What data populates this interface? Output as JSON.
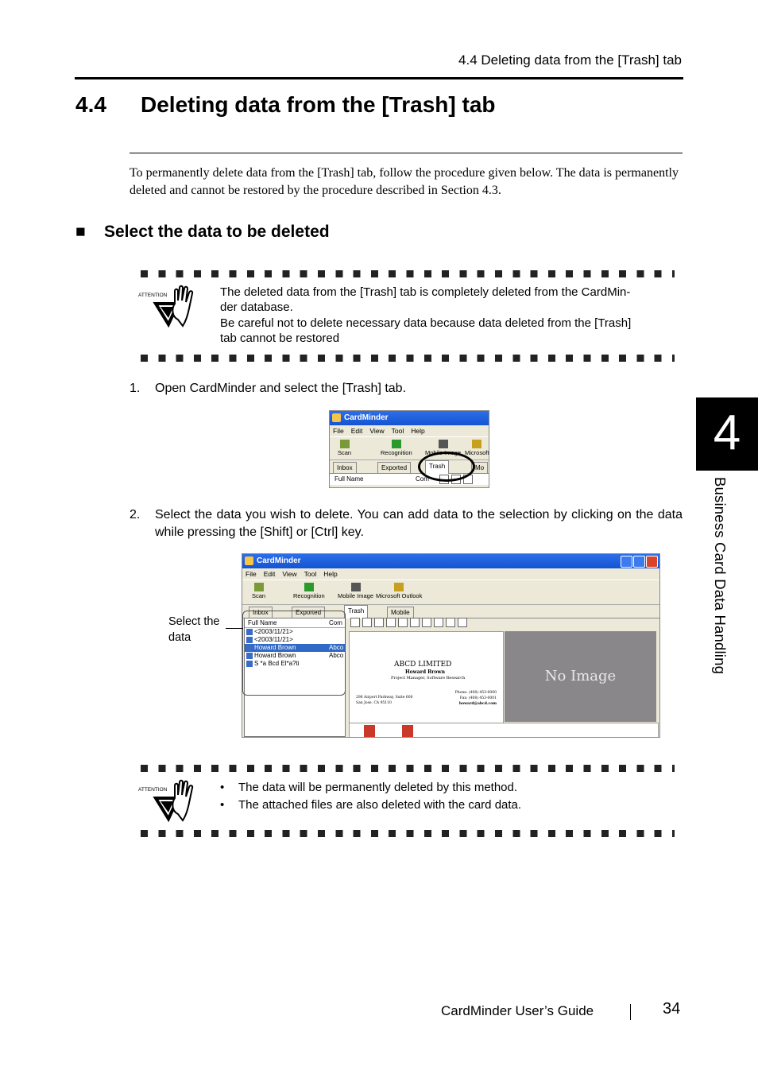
{
  "header": {
    "running_title": "4.4 Deleting data from the [Trash] tab"
  },
  "section": {
    "number": "4.4",
    "title": "Deleting data from the [Trash] tab",
    "intro": "To permanently delete data from the [Trash] tab, follow the procedure given below. The data is permanently deleted and cannot be restored by the procedure described in Section 4.3."
  },
  "subsection": {
    "bullet": "■",
    "title": "Select the data to be deleted"
  },
  "attention1": {
    "icon_label": "ATTENTION",
    "lines": [
      "The deleted data from the [Trash] tab is completely deleted from the CardMin-",
      "der database.",
      "Be careful not to delete necessary data because data deleted from the [Trash]",
      "tab cannot be restored"
    ]
  },
  "steps": [
    {
      "num": "1.",
      "text": "Open CardMinder and select the [Trash] tab."
    },
    {
      "num": "2.",
      "text": "Select the data you wish to delete. You can add data to the selection by clicking on the data while pressing the [Shift] or [Ctrl] key."
    }
  ],
  "screenshot1": {
    "title": "CardMinder",
    "menu": [
      "File",
      "Edit",
      "View",
      "Tool",
      "Help"
    ],
    "tools": [
      "Scan",
      "Recognition",
      "Mobile Image",
      "Microsoft"
    ],
    "tabs": [
      "Inbox",
      "Exported",
      "Trash",
      "Mo"
    ],
    "column": "Full Name",
    "column2": "Com"
  },
  "screenshot2": {
    "title": "CardMinder",
    "menu": [
      "File",
      "Edit",
      "View",
      "Tool",
      "Help"
    ],
    "tools": [
      "Scan",
      "Recognition",
      "Mobile Image",
      "Microsoft Outlook"
    ],
    "tabs": [
      "Inbox",
      "Exported",
      "Trash",
      "Mobile"
    ],
    "column": "Full Name",
    "column2": "Com",
    "rows": [
      {
        "name": "<2003/11/21>",
        "company": ""
      },
      {
        "name": "<2003/11/21>",
        "company": ""
      },
      {
        "name": "Howard Brown",
        "company": "Abco"
      },
      {
        "name": "Howard Brown",
        "company": "Abco"
      },
      {
        "name": "S *a Bcd El*a?ti",
        "company": ""
      }
    ],
    "card": {
      "company": "ABCD LIMITED",
      "name": "Howard Brown",
      "position": "Project Manager, Software Research",
      "address1": "296 Airport Parkway, Suite 600",
      "address2": "San Jose, CA 95110",
      "phone": "Phone: (408) 453-0000",
      "fax": "Fax: (408) 453-0001",
      "email": "howard@abcd.com"
    },
    "no_image": "No Image",
    "callout": "Select the data"
  },
  "attention2": {
    "icon_label": "ATTENTION",
    "bullets": [
      "The data will be permanently deleted by this method.",
      "The attached files are also deleted with the card data."
    ]
  },
  "footer": {
    "title": "CardMinder  User’s Guide",
    "page": "34"
  },
  "chapter": {
    "number": "4",
    "title": "Business Card Data Handling"
  }
}
